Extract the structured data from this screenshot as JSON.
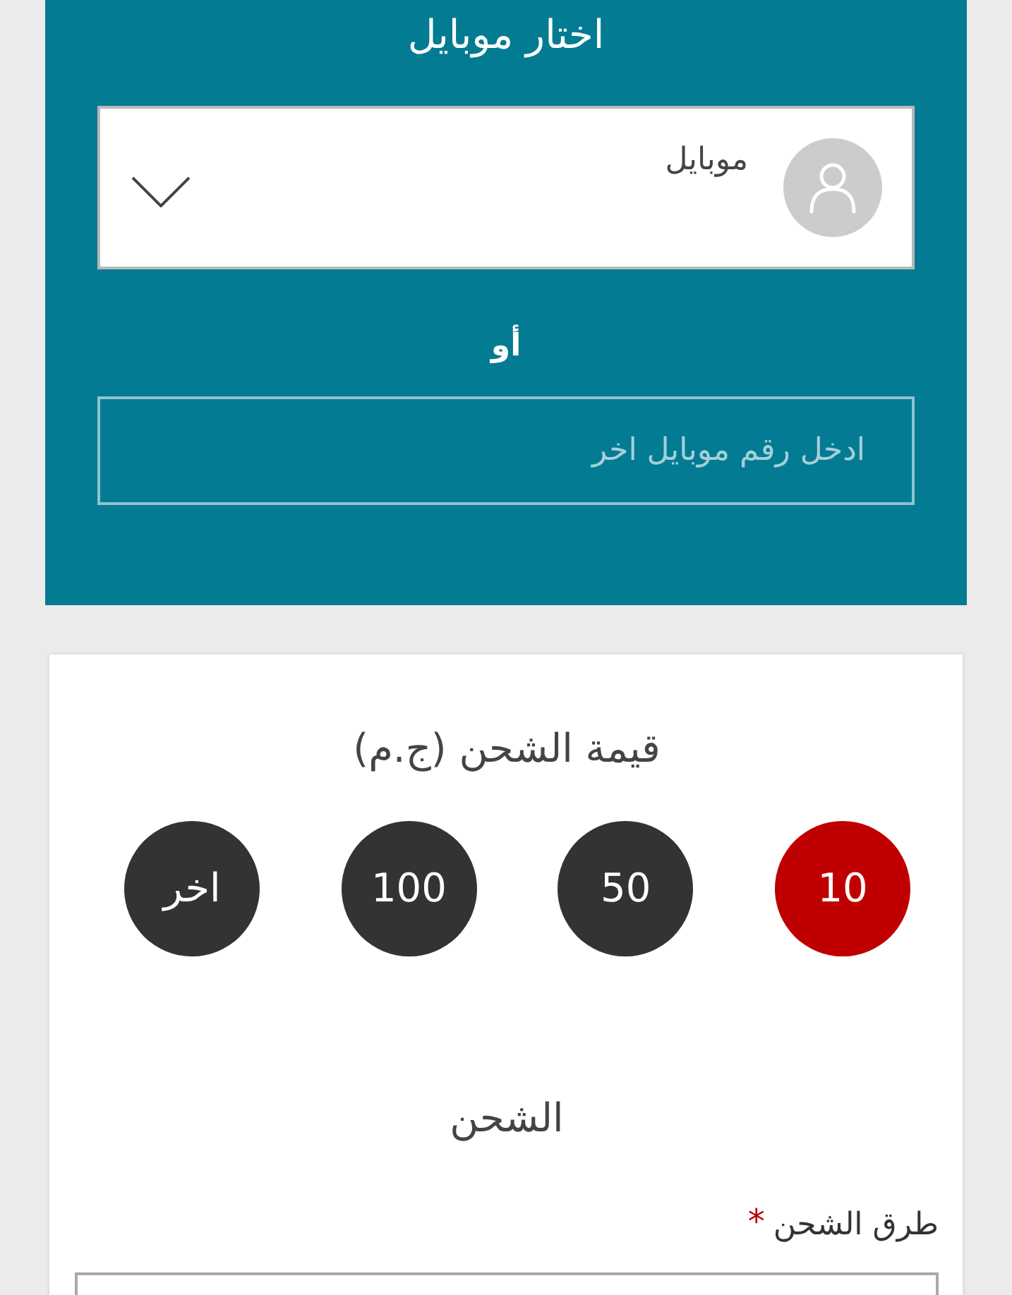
{
  "mobile_panel": {
    "title": "اختار موبايل",
    "select": {
      "value": "موبايل"
    },
    "separator": "أو",
    "other_number": {
      "placeholder": "ادخل رقم موبايل اخر"
    }
  },
  "amount_card": {
    "title": "قيمة الشحن (ج.م)",
    "amounts": [
      {
        "label": "10",
        "selected": true
      },
      {
        "label": "50",
        "selected": false
      },
      {
        "label": "100",
        "selected": false
      },
      {
        "label": "اخر",
        "selected": false
      }
    ],
    "section_title": "الشحن",
    "method_field": {
      "label": "طرق الشحن",
      "required_mark": "*"
    }
  }
}
